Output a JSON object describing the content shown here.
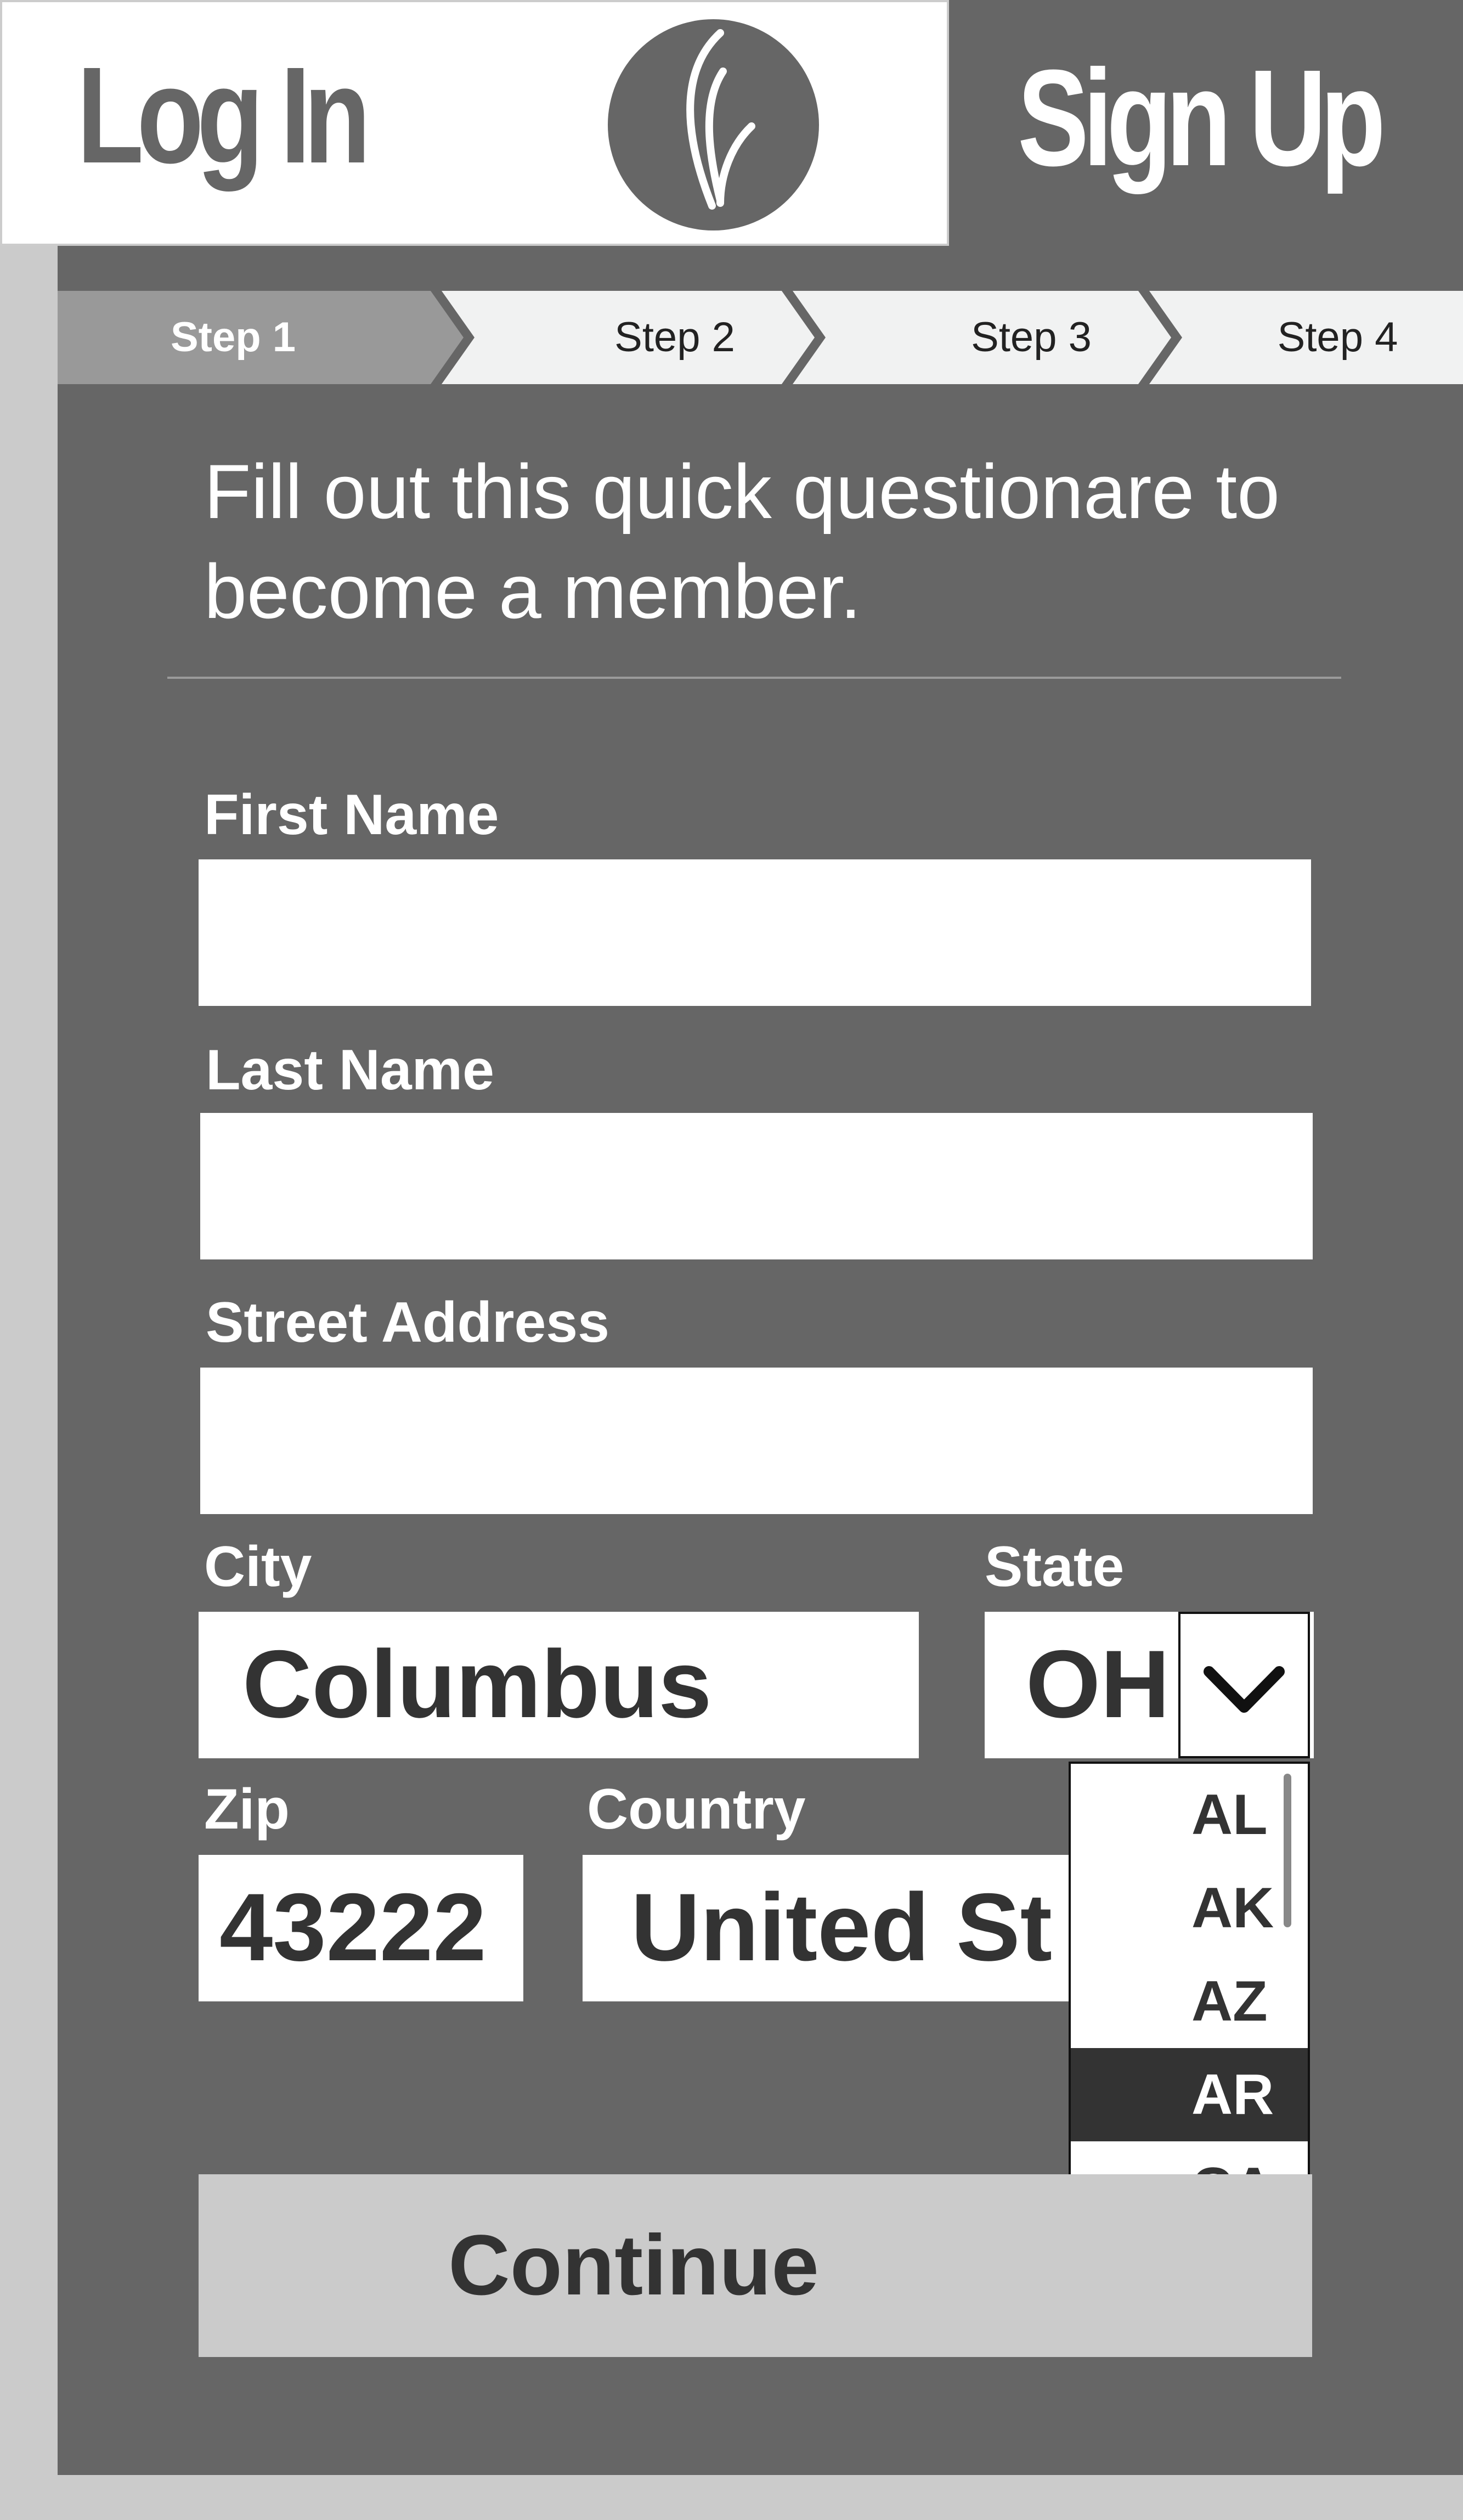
{
  "header": {
    "login_tab": "Log In",
    "signup_tab": "Sign Up",
    "logo_icon": "leaf-logo"
  },
  "stepper": {
    "steps": [
      "Step 1",
      "Step 2",
      "Step 3",
      "Step 4"
    ],
    "active_step": "Step 1"
  },
  "intro": {
    "line1": "Fill out this quick questionare to",
    "line2": "become a member."
  },
  "form": {
    "first_name": {
      "label": "First Name",
      "value": ""
    },
    "last_name": {
      "label": "Last Name",
      "value": ""
    },
    "street": {
      "label": "Street Address",
      "value": ""
    },
    "city": {
      "label": "City",
      "value": "Columbus"
    },
    "state": {
      "label": "State",
      "value": "OH",
      "toggle_icon": "chevron-down-icon",
      "options": [
        "AL",
        "AK",
        "AZ",
        "AR",
        "CA"
      ],
      "highlighted": "AR"
    },
    "zip": {
      "label": "Zip",
      "value": "43222"
    },
    "country": {
      "label": "Country",
      "value": "United St"
    },
    "continue_label": "Continue"
  },
  "colors": {
    "panel": "#666666",
    "page_background": "#cbcbcb",
    "active_step": "#999999",
    "inactive_step": "#f1f2f2",
    "highlight": "#333333"
  }
}
